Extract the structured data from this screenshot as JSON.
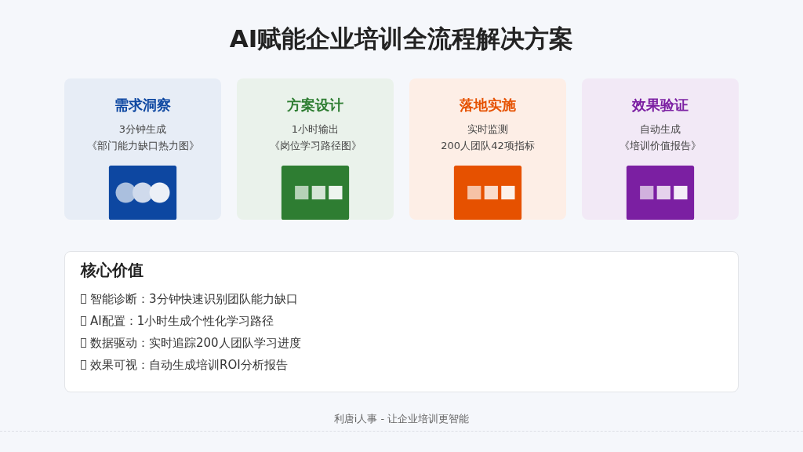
{
  "title": "AI赋能企业培训全流程解决方案",
  "cards": [
    {
      "title": "需求洞察",
      "lines": [
        "3分钟生成",
        "《部门能力缺口热力图》"
      ],
      "color": "#0d47a1",
      "kind": "circles"
    },
    {
      "title": "方案设计",
      "lines": [
        "1小时输出",
        "《岗位学习路径图》"
      ],
      "color": "#2e7d32",
      "kind": "squares"
    },
    {
      "title": "落地实施",
      "lines": [
        "实时监测",
        "200人团队42项指标"
      ],
      "color": "#e65100",
      "kind": "squares"
    },
    {
      "title": "效果验证",
      "lines": [
        "自动生成",
        "《培训价值报告》"
      ],
      "color": "#7b1fa2",
      "kind": "squares"
    }
  ],
  "core": {
    "heading": "核心价值",
    "items": [
      "智能诊断：3分钟快速识别团队能力缺口",
      "AI配置：1小时生成个性化学习路径",
      "数据驱动：实时追踪200人团队学习进度",
      "效果可视：自动生成培训ROI分析报告"
    ]
  },
  "footer": "利唐i人事 - 让企业培训更智能"
}
